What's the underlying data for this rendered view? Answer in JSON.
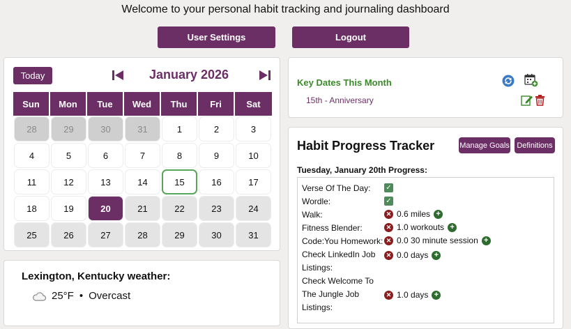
{
  "header": {
    "welcome": "Welcome to your personal habit tracking and journaling dashboard"
  },
  "buttons": {
    "user_settings": "User Settings",
    "logout": "Logout"
  },
  "calendar": {
    "today_label": "Today",
    "month_title": "January 2026",
    "weekdays": [
      "Sun",
      "Mon",
      "Tue",
      "Wed",
      "Thu",
      "Fri",
      "Sat"
    ],
    "days": [
      "28",
      "29",
      "30",
      "31",
      "1",
      "2",
      "3",
      "4",
      "5",
      "6",
      "7",
      "8",
      "9",
      "10",
      "11",
      "12",
      "13",
      "14",
      "15",
      "16",
      "17",
      "18",
      "19",
      "20",
      "21",
      "22",
      "23",
      "24",
      "25",
      "26",
      "27",
      "28",
      "29",
      "30",
      "31"
    ],
    "prev_month_count": 4,
    "selected_day_index": 23,
    "highlighted_day_index": 18,
    "past_grey_from_index": 24
  },
  "weather": {
    "title": "Lexington, Kentucky weather:",
    "temp": "25°F",
    "separator": "•",
    "condition": "Overcast",
    "icon": "cloud-icon"
  },
  "key_dates": {
    "title": "Key Dates This Month",
    "items": [
      "15th - Anniversary"
    ]
  },
  "habits": {
    "title": "Habit Progress Tracker",
    "manage_goals": "Manage Goals",
    "definitions": "Definitions",
    "date_label": "Tuesday, January 20th Progress:",
    "items": [
      {
        "name": "Verse Of The Day:",
        "done": true,
        "value": ""
      },
      {
        "name": "Wordle:",
        "done": true,
        "value": ""
      },
      {
        "name": "Walk:",
        "done": false,
        "value": "0.6 miles"
      },
      {
        "name": "Fitness Blender:",
        "done": false,
        "value": "1.0 workouts"
      },
      {
        "name": "Code:You Homework:",
        "done": false,
        "value": "0.0 30 minute session"
      },
      {
        "name": "Check LinkedIn Job Listings:",
        "done": false,
        "value": "0.0 days"
      },
      {
        "name": "Check Welcome To The Jungle Job Listings:",
        "done": false,
        "value": "1.0 days"
      }
    ]
  },
  "colors": {
    "accent": "#6b2f66",
    "green": "#3a8a2a"
  }
}
